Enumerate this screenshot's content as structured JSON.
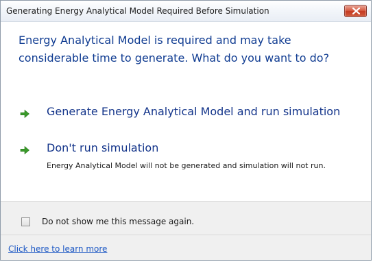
{
  "window": {
    "title": "Generating Energy Analytical Model Required Before Simulation"
  },
  "main_instruction": "Energy Analytical Model is required and may take considerable time to generate. What do you want to do?",
  "options": [
    {
      "label": "Generate Energy Analytical Model and run simulation",
      "icon": "green-arrow-icon"
    },
    {
      "label": "Don't run simulation",
      "note": "Energy Analytical Model will not be generated and simulation will not run.",
      "icon": "green-arrow-icon"
    }
  ],
  "footer": {
    "checkbox_label": "Do not show me this message again.",
    "checkbox_checked": false,
    "link_label": "Click here to learn more"
  },
  "colors": {
    "instruction_text": "#0f3b91",
    "link_text": "#13348a",
    "arrow_green": "#3a9a2a",
    "close_red": "#c53a22"
  }
}
